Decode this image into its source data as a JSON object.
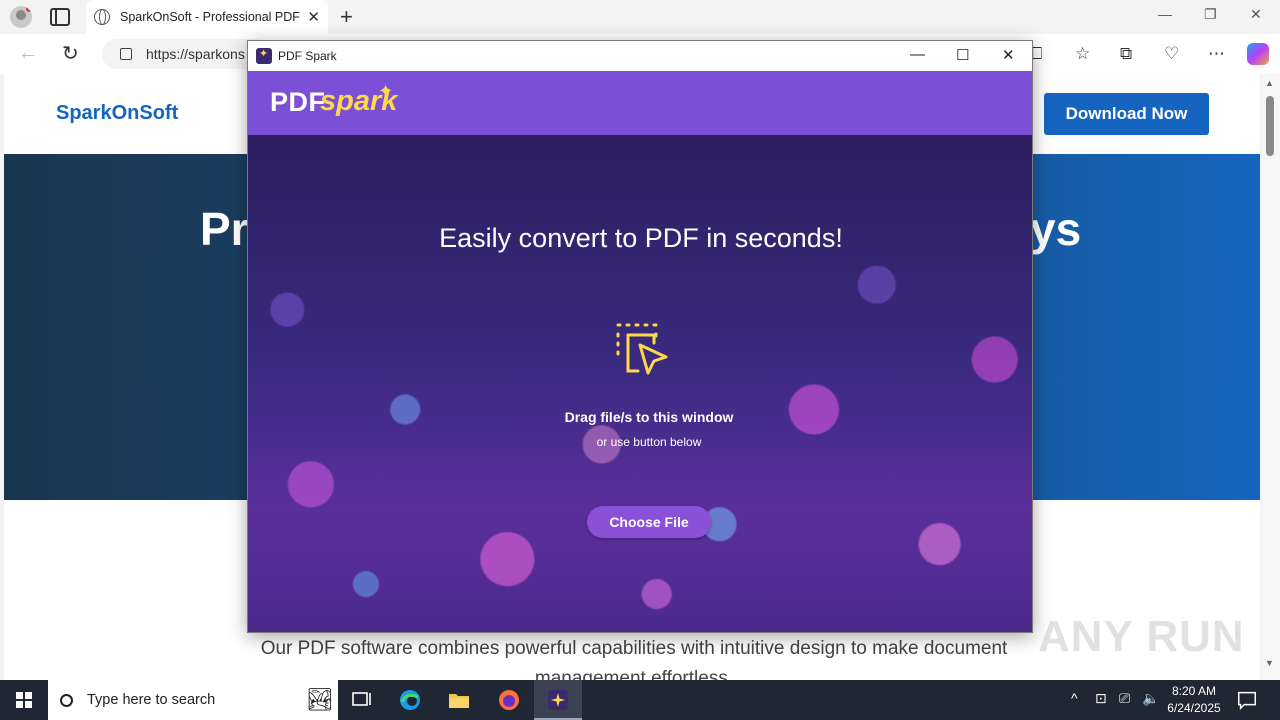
{
  "browser": {
    "tab_title": "SparkOnSoft - Professional PDF S",
    "url": "https://sparkons",
    "tab_close": "✕",
    "new_tab": "+",
    "window_controls": [
      "—",
      "❐",
      "✕"
    ]
  },
  "website": {
    "logo": "SparkOnSoft",
    "download_button": "Download Now",
    "hero_left": "Pr",
    "hero_right": "ys",
    "description": "Our PDF software combines powerful capabilities with intuitive design to make document management effortless."
  },
  "app": {
    "window_title": "PDF Spark",
    "controls": [
      "—",
      "☐",
      "✕"
    ],
    "brand_pdf": "PDF",
    "brand_spark": "spark",
    "headline": "Easily convert to PDF in seconds!",
    "drag_main": "Drag file/s to this window",
    "drag_sub": "or use button below",
    "choose_button": "Choose File",
    "colors": {
      "header": "#7b4fd6",
      "accent": "#ffd84a",
      "button": "#8a50d8"
    }
  },
  "watermark": "ANY RUN",
  "taskbar": {
    "search_placeholder": "Type here to search",
    "time": "8:20 AM",
    "date": "6/24/2025"
  }
}
